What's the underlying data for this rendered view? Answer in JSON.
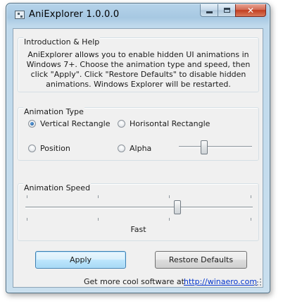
{
  "window": {
    "title": "AniExplorer 1.0.0.0"
  },
  "intro": {
    "legend": "Introduction & Help",
    "text": "AniExplorer allows you to enable hidden UI animations in Windows 7+. Choose the animation type and speed, then click \"Apply\". Click \"Restore Defaults\" to disable hidden animations. Windows Explorer will be restarted."
  },
  "animation_type": {
    "legend": "Animation Type",
    "options": [
      {
        "label": "Vertical Rectangle",
        "checked": true
      },
      {
        "label": "Horisontal Rectangle",
        "checked": false
      },
      {
        "label": "Position",
        "checked": false
      },
      {
        "label": "Alpha",
        "checked": false
      }
    ],
    "alpha_level": 0.33
  },
  "animation_speed": {
    "legend": "Animation Speed",
    "level": 0.67,
    "value_label": "Fast"
  },
  "buttons": {
    "apply": "Apply",
    "restore": "Restore Defaults"
  },
  "footer": {
    "text": "Get more cool software at",
    "link": "http://winaero.com"
  },
  "icons": [
    "app-icon",
    "minimize-icon",
    "maximize-icon",
    "close-icon",
    "size-grip-icon"
  ]
}
